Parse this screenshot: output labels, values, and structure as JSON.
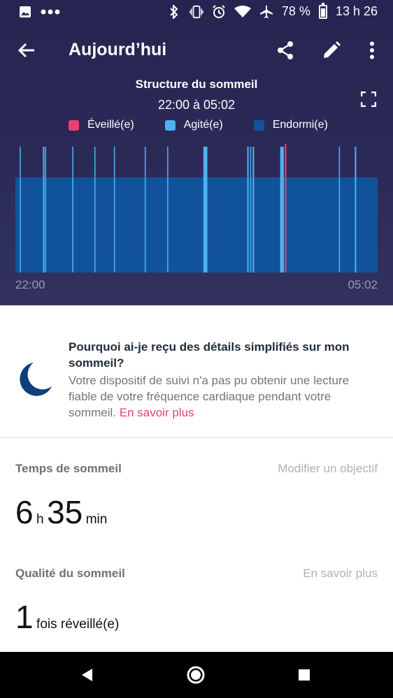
{
  "status_bar": {
    "battery": "78 %",
    "time": "13 h 26",
    "icons": [
      "image-icon",
      "more-dots-icon",
      "bluetooth-icon",
      "vibrate-icon",
      "alarm-icon",
      "wifi-icon",
      "airplane-icon",
      "battery-icon"
    ]
  },
  "app_bar": {
    "title": "Aujourd’hui",
    "actions": [
      "back-icon",
      "share-icon",
      "edit-icon",
      "more-vert-icon"
    ]
  },
  "chart_data": {
    "type": "bar",
    "title": "Structure du sommeil",
    "subtitle": "22:00 à 05:02",
    "time_range": [
      "22:00",
      "05:02"
    ],
    "legend": [
      {
        "name": "Éveillé(e)",
        "color": "#ee3f72"
      },
      {
        "name": "Agité(e)",
        "color": "#4cb2f2"
      },
      {
        "name": "Endormi(e)",
        "color": "#11539a"
      }
    ],
    "legend_placement": "top",
    "levels": {
      "awake": 3,
      "restless": 2,
      "asleep": 1
    },
    "asleep": {
      "start": 0,
      "end": 1
    },
    "restless_events": [
      {
        "t": 0.012,
        "w": 0.003
      },
      {
        "t": 0.076,
        "w": 0.004
      },
      {
        "t": 0.082,
        "w": 0.003
      },
      {
        "t": 0.157,
        "w": 0.003
      },
      {
        "t": 0.218,
        "w": 0.003
      },
      {
        "t": 0.272,
        "w": 0.003
      },
      {
        "t": 0.357,
        "w": 0.003
      },
      {
        "t": 0.419,
        "w": 0.003
      },
      {
        "t": 0.519,
        "w": 0.011
      },
      {
        "t": 0.64,
        "w": 0.004
      },
      {
        "t": 0.648,
        "w": 0.003
      },
      {
        "t": 0.655,
        "w": 0.004
      },
      {
        "t": 0.731,
        "w": 0.01
      },
      {
        "t": 0.893,
        "w": 0.003
      },
      {
        "t": 0.937,
        "w": 0.004
      }
    ],
    "awake_events": [
      {
        "t": 0.744,
        "w": 0.004
      }
    ]
  },
  "info_card": {
    "title": "Pourquoi ai-je reçu des détails simplifiés sur mon sommeil?",
    "body": "Votre dispositif de suivi n'a pas pu obtenir une lecture fiable de votre fréquence cardiaque pendant votre sommeil.",
    "link": "En savoir plus",
    "icon": "moon-icon"
  },
  "sleep_time": {
    "label": "Temps de sommeil",
    "action": "Modifier un objectif",
    "hours": "6",
    "hours_unit": "h",
    "minutes": "35",
    "minutes_unit": "min"
  },
  "sleep_quality": {
    "label": "Qualité du sommeil",
    "action": "En savoir plus",
    "count": "1",
    "count_unit": "fois réveillé(e)"
  },
  "nav_bar": {
    "buttons": [
      "back-triangle-icon",
      "home-circle-icon",
      "recents-square-icon"
    ]
  }
}
